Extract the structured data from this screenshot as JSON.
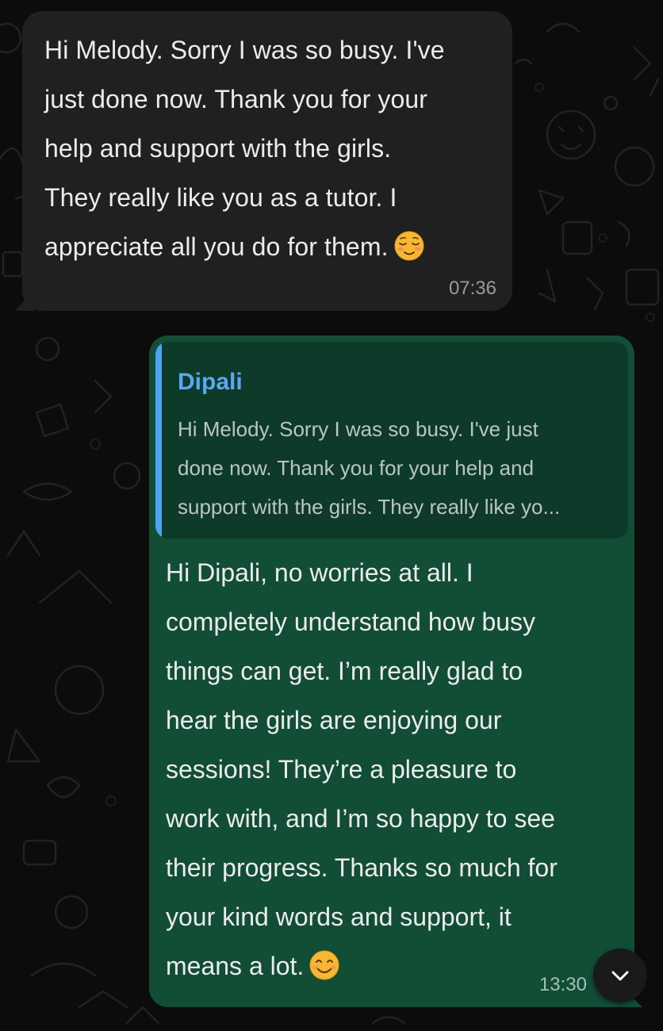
{
  "incoming": {
    "text": "Hi Melody. Sorry I was so busy. I've\njust done now. Thank you for your\nhelp and support with the girls.\nThey really like you as a tutor. I\nappreciate all you do for them.",
    "emoji_icon": "relieved-face-emoji",
    "time": "07:36"
  },
  "outgoing": {
    "quote": {
      "author": "Dipali",
      "text": "Hi Melody. Sorry I was so busy. I've just\ndone now. Thank you for your help and\nsupport with the girls. They really like yo..."
    },
    "text": "Hi Dipali, no worries at all. I\ncompletely understand how busy\nthings can get. I’m really glad to\nhear the girls are enjoying our\nsessions! They’re a pleasure to\nwork with, and I’m so happy to see\ntheir progress. Thanks so much for\nyour kind words and support, it\nmeans a lot.",
    "emoji_icon": "smiling-face-emoji",
    "time": "13:30"
  },
  "scroll_button": {
    "icon": "chevron-down-icon"
  },
  "colors": {
    "incoming_bubble": "#202020",
    "outgoing_bubble": "#124d36",
    "quote_background": "#0e3a29",
    "quote_accent": "#4aa3f5",
    "author_name": "#58a9f1"
  }
}
